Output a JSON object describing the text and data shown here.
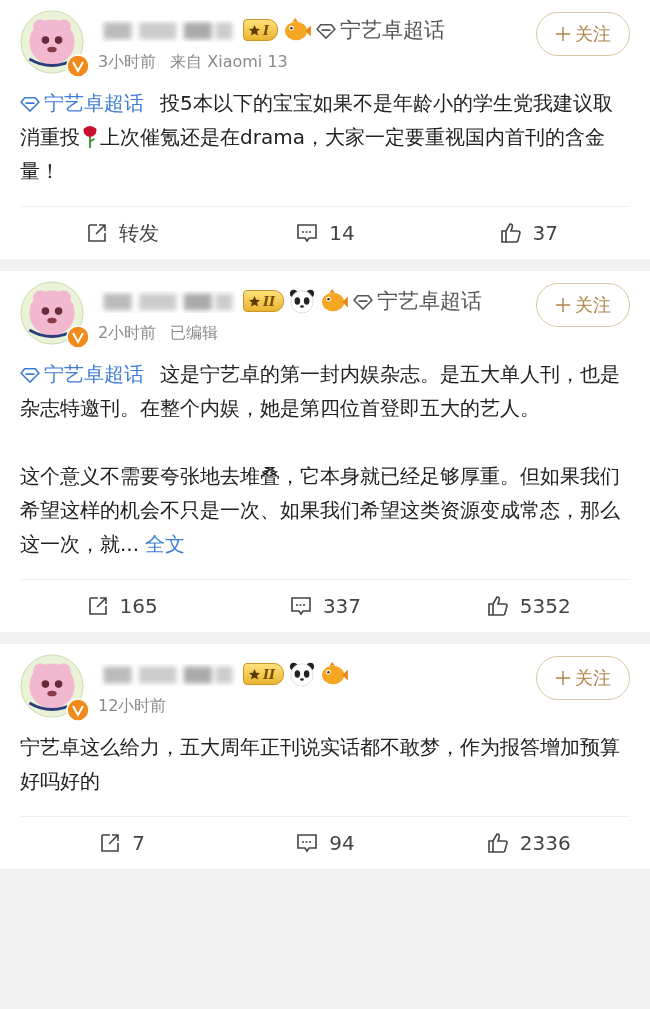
{
  "posts": [
    {
      "avatar": {
        "kind": "picture"
      },
      "verified": true,
      "badge": "I",
      "badge_icons": [
        {
          "kind": "fish"
        }
      ],
      "topic": "宁艺卓超话",
      "meta": [
        "3小时前",
        "来自 Xiaomi 13"
      ],
      "follow": "关注",
      "paragraphs": [
        [
          {
            "kind": "topic",
            "text": "宁艺卓超话"
          },
          {
            "kind": "text",
            "text": "投5本以下的宝宝如果不是年龄小的学生党我建议取消重投"
          },
          {
            "kind": "emoji"
          },
          {
            "kind": "text",
            "text": "上次催氪还是在drama，大家一定要重视国内首刊的含金量！"
          }
        ]
      ],
      "actions": [
        {
          "kind": "repost",
          "label": "转发"
        },
        {
          "kind": "comment",
          "label": "14"
        },
        {
          "kind": "like",
          "label": "37"
        }
      ]
    },
    {
      "avatar": {
        "kind": "picture"
      },
      "verified": true,
      "badge": "II",
      "badge_icons": [
        {
          "kind": "panda"
        },
        {
          "kind": "fish"
        }
      ],
      "topic": "宁艺卓超话",
      "meta": [
        "2小时前",
        "已编辑"
      ],
      "follow": "关注",
      "paragraphs": [
        [
          {
            "kind": "topic",
            "text": "宁艺卓超话"
          },
          {
            "kind": "text",
            "text": "这是宁艺卓的第一封内娱杂志。是五大单人刊，也是杂志特邀刊。在整个内娱，她是第四位首登即五大的艺人。"
          }
        ],
        [
          {
            "kind": "text",
            "text": "这个意义不需要夸张地去堆叠，它本身就已经足够厚重。但如果我们希望这样的机会不只是一次、如果我们希望这类资源变成常态，那么这一次，就..."
          },
          {
            "kind": "more",
            "text": "全文"
          }
        ]
      ],
      "actions": [
        {
          "kind": "repost",
          "label": "165"
        },
        {
          "kind": "comment",
          "label": "337"
        },
        {
          "kind": "like",
          "label": "5352"
        }
      ]
    },
    {
      "avatar": {
        "kind": "picture"
      },
      "verified": true,
      "badge": "II",
      "badge_icons": [
        {
          "kind": "panda"
        },
        {
          "kind": "fish"
        }
      ],
      "meta": [
        "12小时前"
      ],
      "follow": "关注",
      "paragraphs": [
        [
          {
            "kind": "text",
            "text": "宁艺卓这么给力，五大周年正刊说实话都不敢梦，作为报答增加预算好吗好的"
          }
        ]
      ],
      "actions": [
        {
          "kind": "repost",
          "label": "7"
        },
        {
          "kind": "comment",
          "label": "94"
        },
        {
          "kind": "like",
          "label": "2336"
        }
      ]
    }
  ]
}
